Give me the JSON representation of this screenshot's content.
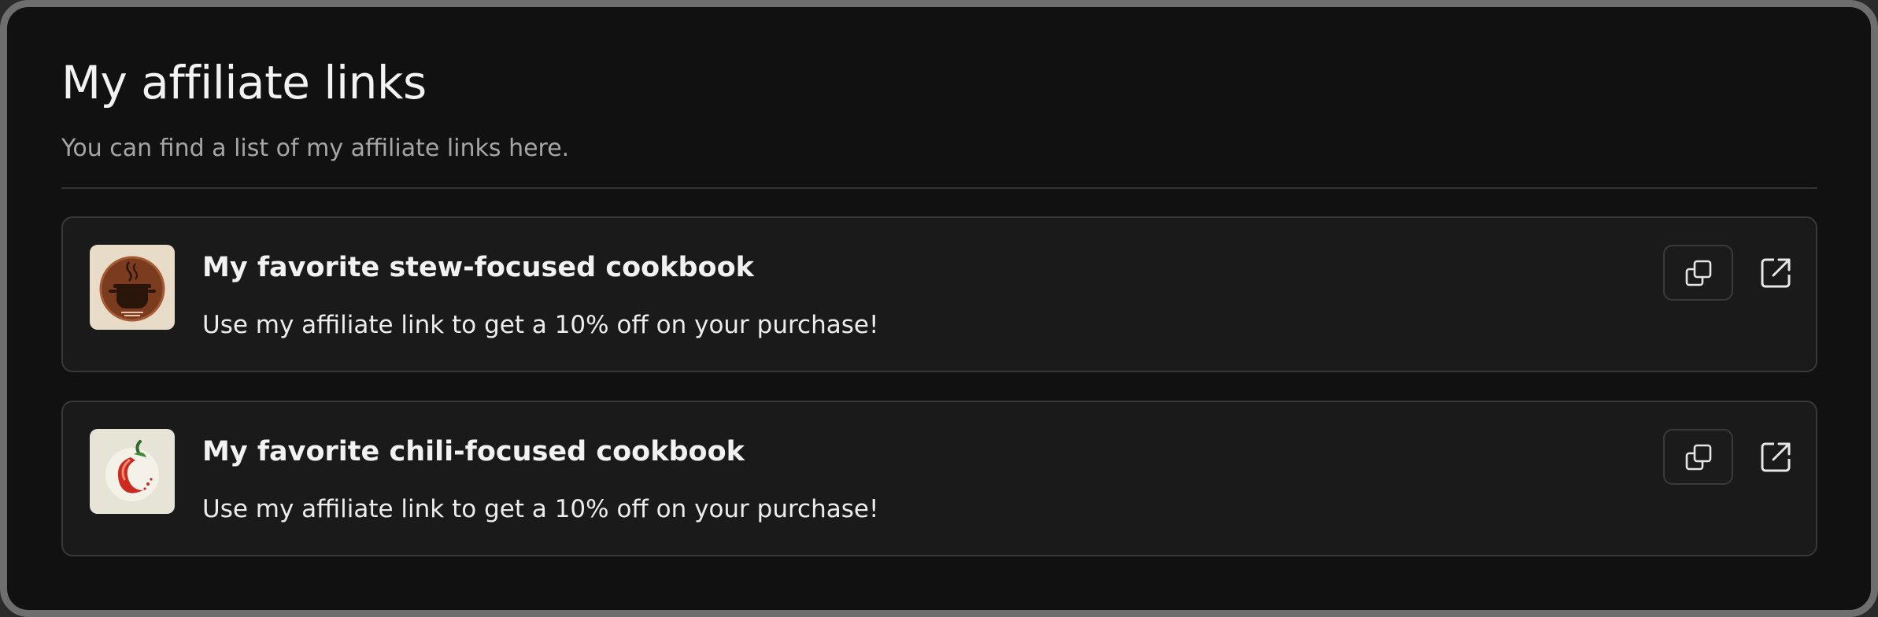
{
  "header": {
    "title": "My affiliate links",
    "subtitle": "You can find a list of my affiliate links here."
  },
  "links": [
    {
      "title": "My favorite stew-focused cookbook",
      "description": "Use my affiliate link to get a 10% off on your purchase!",
      "thumbnail_icon": "stew-pot-icon",
      "thumbnail_colors": {
        "background": "#e8dcc8",
        "badge": "#7a3b1f"
      }
    },
    {
      "title": "My favorite chili-focused cookbook",
      "description": "Use my affiliate link to get a 10% off on your purchase!",
      "thumbnail_icon": "chili-pepper-icon",
      "thumbnail_colors": {
        "background": "#e6e4d6",
        "pepper": "#cc2a1e"
      }
    }
  ],
  "actions": {
    "copy_icon": "copy-icon",
    "open_icon": "external-link-icon"
  },
  "colors": {
    "background": "#111111",
    "card": "#1a1a1a",
    "border": "#383838",
    "text_primary": "#f2f2f2",
    "text_secondary": "#a6a6a6"
  }
}
